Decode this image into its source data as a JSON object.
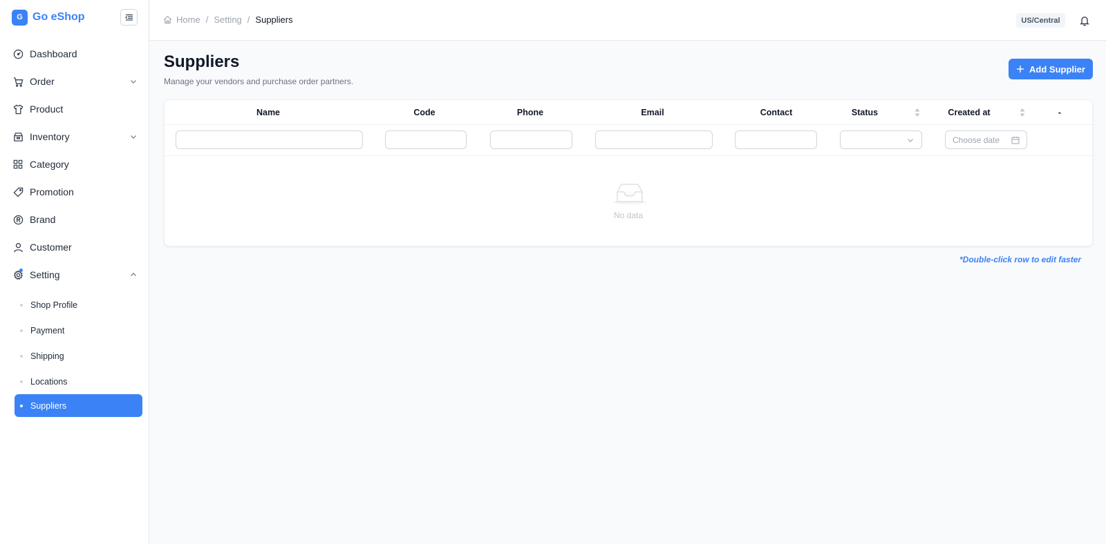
{
  "brand": {
    "logo_letter": "G",
    "name": "Go eShop"
  },
  "sidebar": {
    "items": [
      {
        "label": "Dashboard",
        "icon": "dashboard-icon"
      },
      {
        "label": "Order",
        "icon": "cart-icon",
        "expandable": true
      },
      {
        "label": "Product",
        "icon": "shirt-icon"
      },
      {
        "label": "Inventory",
        "icon": "box-icon",
        "expandable": true
      },
      {
        "label": "Category",
        "icon": "grid-icon"
      },
      {
        "label": "Promotion",
        "icon": "tag-icon"
      },
      {
        "label": "Brand",
        "icon": "registered-icon"
      },
      {
        "label": "Customer",
        "icon": "user-icon"
      },
      {
        "label": "Setting",
        "icon": "gear-icon",
        "expanded": true
      }
    ],
    "setting_children": [
      {
        "label": "Shop Profile"
      },
      {
        "label": "Payment"
      },
      {
        "label": "Shipping"
      },
      {
        "label": "Locations"
      },
      {
        "label": "Suppliers",
        "active": true
      }
    ]
  },
  "header": {
    "breadcrumb": {
      "home": "Home",
      "sep": "/",
      "parent": "Setting",
      "current": "Suppliers"
    },
    "timezone": "US/Central"
  },
  "page": {
    "title": "Suppliers",
    "subtitle": "Manage your vendors and purchase order partners.",
    "add_button": "Add Supplier"
  },
  "table": {
    "columns": [
      "Name",
      "Code",
      "Phone",
      "Email",
      "Contact",
      "Status",
      "Created at",
      "-"
    ],
    "filters": {
      "date_placeholder": "Choose date"
    },
    "empty_text": "No data"
  },
  "hint": "*Double-click row to edit faster",
  "colors": {
    "accent": "#3b82f6",
    "sidebar_bg": "#ffffff",
    "page_bg": "#f8fafc"
  }
}
